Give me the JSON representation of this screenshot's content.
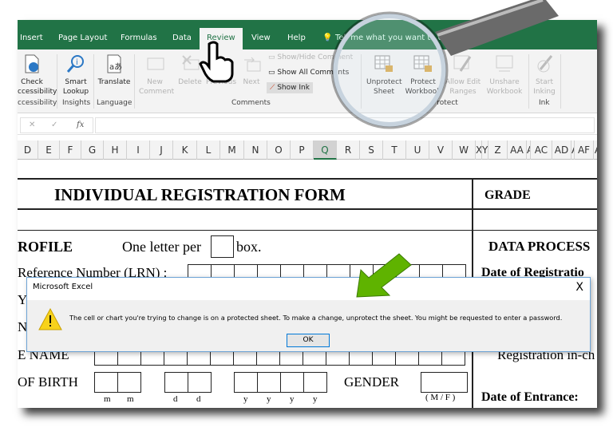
{
  "ribbon_tabs": [
    "Insert",
    "Page Layout",
    "Formulas",
    "Data",
    "Review",
    "View",
    "Help"
  ],
  "active_tab": "Review",
  "tell_me": "Tell me what you want to do",
  "ribbon": {
    "check_accessibility": "Check Accessibility",
    "accessibility_group": "Accessibility",
    "smart_lookup": "Smart Lookup",
    "insights_group": "Insights",
    "translate": "Translate",
    "language_group": "Language",
    "new_comment": "New Comment",
    "delete": "Delete",
    "previous": "Previous",
    "next": "Next",
    "show_hide_comment": "Show/Hide Comment",
    "show_all_comments": "Show All Comments",
    "show_ink": "Show Ink",
    "comments_group": "Comments",
    "unprotect_sheet": "Unprotect Sheet",
    "protect_workbook": "Protect Workbook",
    "allow_edit_ranges": "Allow Edit Ranges",
    "unshare_workbook": "Unshare Workbook",
    "protect_group": "Protect",
    "start_inking": "Start Inking",
    "ink_group": "Ink"
  },
  "formula_bar": {
    "cancel": "✕",
    "enter": "✓",
    "fx": "fx",
    "value": ""
  },
  "columns": [
    "D",
    "E",
    "F",
    "G",
    "H",
    "I",
    "J",
    "K",
    "L",
    "M",
    "N",
    "O",
    "P",
    "Q",
    "R",
    "S",
    "T",
    "U",
    "V",
    "W",
    "X",
    "Y",
    "Z",
    "AA",
    "AB",
    "AC",
    "AD",
    "AE",
    "AF",
    "AG"
  ],
  "selected_column": "Q",
  "form": {
    "title": "INDIVIDUAL REGISTRATION FORM",
    "grade": "GRADE",
    "profile": "ROFILE",
    "one_letter": "One letter per",
    "box": "box.",
    "data_process": "DATA PROCESS",
    "lrn": "Reference Number (LRN) :",
    "date_of_registration": "Date of Registratio",
    "row_y": "Y",
    "row_na": "NA",
    "middle_name": "E NAME",
    "registration_in_charge": "Registration in-ch",
    "date_of_birth": "OF BIRTH",
    "gender": "GENDER",
    "mf": "( M / F )",
    "date_of_entrance": "Date of Entrance:",
    "date_labels": [
      "m",
      "m",
      "d",
      "d",
      "y",
      "y",
      "y",
      "y"
    ]
  },
  "dialog": {
    "title": "Microsoft Excel",
    "close": "X",
    "message": "The cell or chart you're trying to change is on a protected sheet. To make a change, unprotect the sheet. You might be requested to enter a password.",
    "ok": "OK",
    "icon": "warning-icon"
  },
  "colors": {
    "excel_green": "#217346",
    "arrow_green": "#5fb300",
    "warning_yellow": "#f7d21c"
  }
}
